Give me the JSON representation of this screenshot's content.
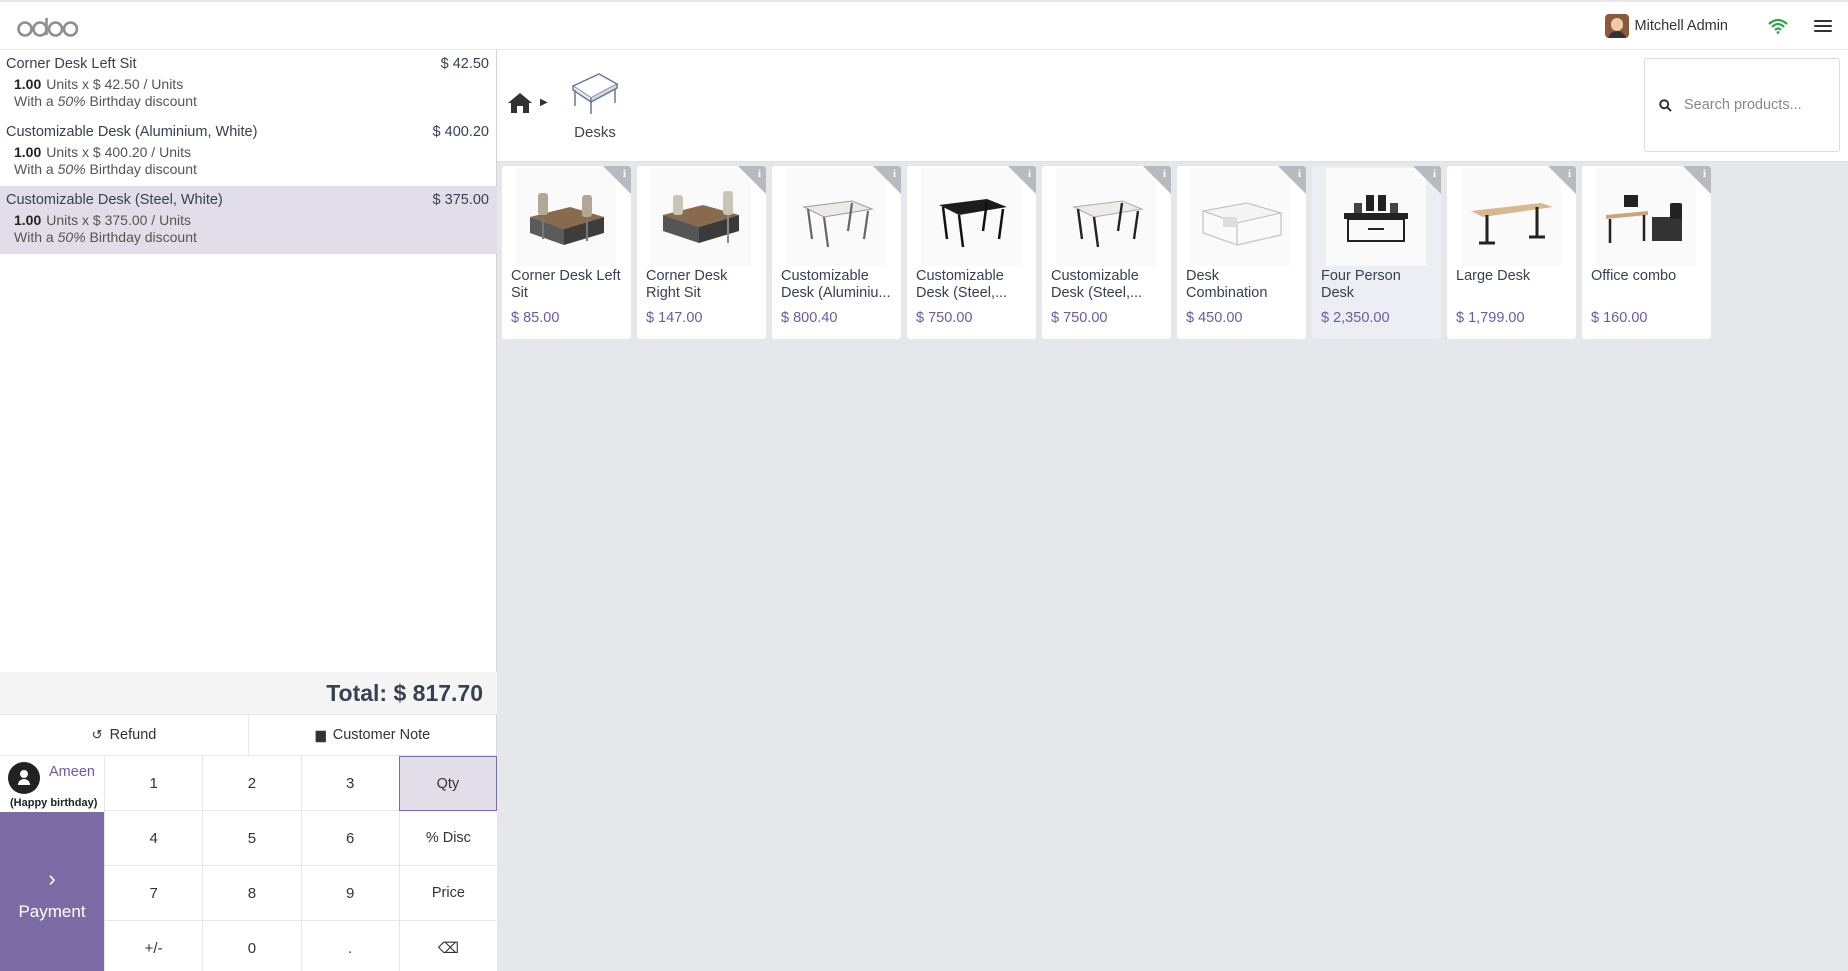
{
  "header": {
    "user_name": "Mitchell Admin"
  },
  "orderlines": [
    {
      "name": "Corner Desk Left Sit",
      "price": "$ 42.50",
      "qty": "1.00",
      "unit_info": "Units x $ 42.50 / Units",
      "disc_pre": "With a ",
      "disc_pct": "50%",
      "disc_post": " Birthday discount"
    },
    {
      "name": "Customizable Desk (Aluminium, White)",
      "price": "$ 400.20",
      "qty": "1.00",
      "unit_info": "Units x $ 400.20 / Units",
      "disc_pre": "With a ",
      "disc_pct": "50%",
      "disc_post": " Birthday discount"
    },
    {
      "name": "Customizable Desk (Steel, White)",
      "price": "$ 375.00",
      "qty": "1.00",
      "unit_info": "Units x $ 375.00 / Units",
      "disc_pre": "With a ",
      "disc_pct": "50%",
      "disc_post": " Birthday discount"
    }
  ],
  "total": "Total: $ 817.70",
  "controls": {
    "refund": "Refund",
    "customer_note": "Customer Note"
  },
  "customer": {
    "name": "Ameen",
    "note": "(Happy birthday)"
  },
  "payment_label": "Payment",
  "numpad": [
    "1",
    "2",
    "3",
    "Qty",
    "4",
    "5",
    "6",
    "% Disc",
    "7",
    "8",
    "9",
    "Price",
    "+/-",
    "0",
    ".",
    "⌫"
  ],
  "category": {
    "label": "Desks"
  },
  "search": {
    "placeholder": "Search products..."
  },
  "products": [
    {
      "name": "Corner Desk Left Sit",
      "price": "$ 85.00"
    },
    {
      "name": "Corner Desk Right Sit",
      "price": "$ 147.00"
    },
    {
      "name": "Customizable Desk (Aluminiu...",
      "price": "$ 800.40"
    },
    {
      "name": "Customizable Desk (Steel,...",
      "price": "$ 750.00"
    },
    {
      "name": "Customizable Desk (Steel,...",
      "price": "$ 750.00"
    },
    {
      "name": "Desk Combination",
      "price": "$ 450.00"
    },
    {
      "name": "Four Person Desk",
      "price": "$ 2,350.00"
    },
    {
      "name": "Large Desk",
      "price": "$ 1,799.00"
    },
    {
      "name": "Office combo",
      "price": "$ 160.00"
    }
  ],
  "colors": {
    "brand": "#7c6ca6",
    "selected_row": "#e1deea",
    "price_text": "#6c5aa0",
    "wifi": "#28a745"
  }
}
